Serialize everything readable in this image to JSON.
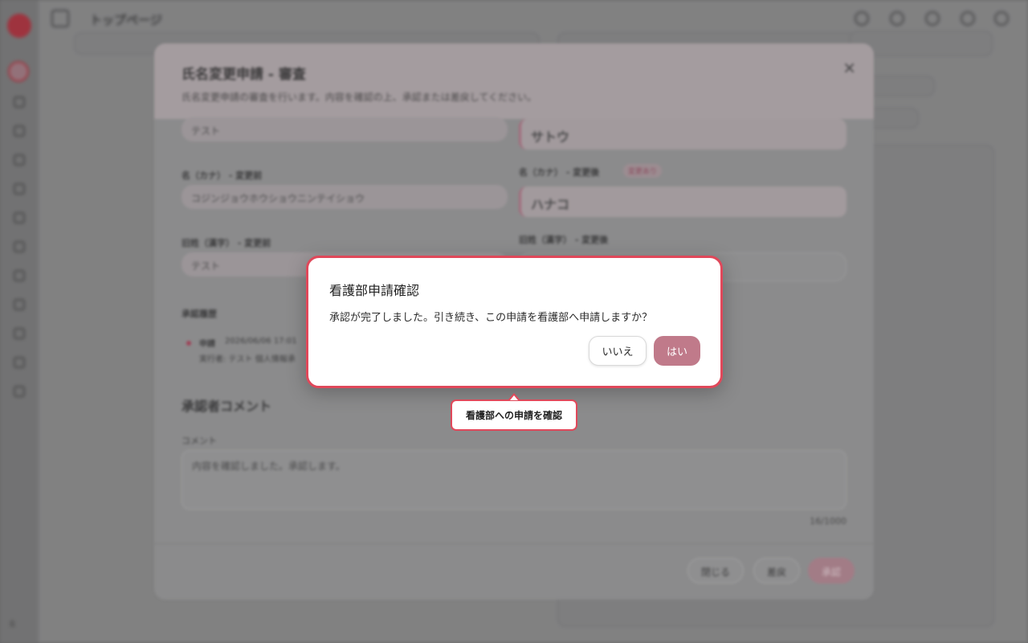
{
  "app": {
    "title": "トップページ",
    "version": "ß"
  },
  "review_modal": {
    "title": "氏名変更申請 - 審査",
    "subtitle": "氏名変更申請の審査を行います。内容を確認の上、承認または差戻してください。",
    "close_icon": "×",
    "fields": {
      "sei_kana_before_value": "テスト",
      "sei_kana_after_value": "サトウ",
      "mei_kana_before_label": "名（カナ） - 変更前",
      "mei_kana_before_value": "コジンジョウホウショウニンテイショウ",
      "mei_kana_after_label": "名（カナ） - 変更後",
      "mei_kana_after_badge": "変更あり",
      "mei_kana_after_value": "ハナコ",
      "kyusei_before_label": "旧姓（漢字） - 変更前",
      "kyusei_before_value": "テスト",
      "kyusei_after_label": "旧姓（漢字） - 変更後"
    },
    "history": {
      "label": "承認履歴",
      "entry_type": "申請",
      "entry_date": "2026/06/06 17:01",
      "entry_actor": "実行者: テスト 個人情報承"
    },
    "comment_section_title": "承認者コメント",
    "comment_label": "コメント",
    "comment_value": "内容を確認しました。承認します。",
    "comment_count": "16/1000",
    "close_button": "閉じる",
    "reject_button": "差戻",
    "approve_button": "承認"
  },
  "confirm_dialog": {
    "title": "看護部申請確認",
    "message": "承認が完了しました。引き続き、この申請を看護部へ申請しますか？",
    "no_button": "いいえ",
    "yes_button": "はい"
  },
  "tooltip": {
    "text": "看護部への申請を確認"
  },
  "colors": {
    "accent": "#c07a8a",
    "highlight_border": "#e0485a"
  }
}
